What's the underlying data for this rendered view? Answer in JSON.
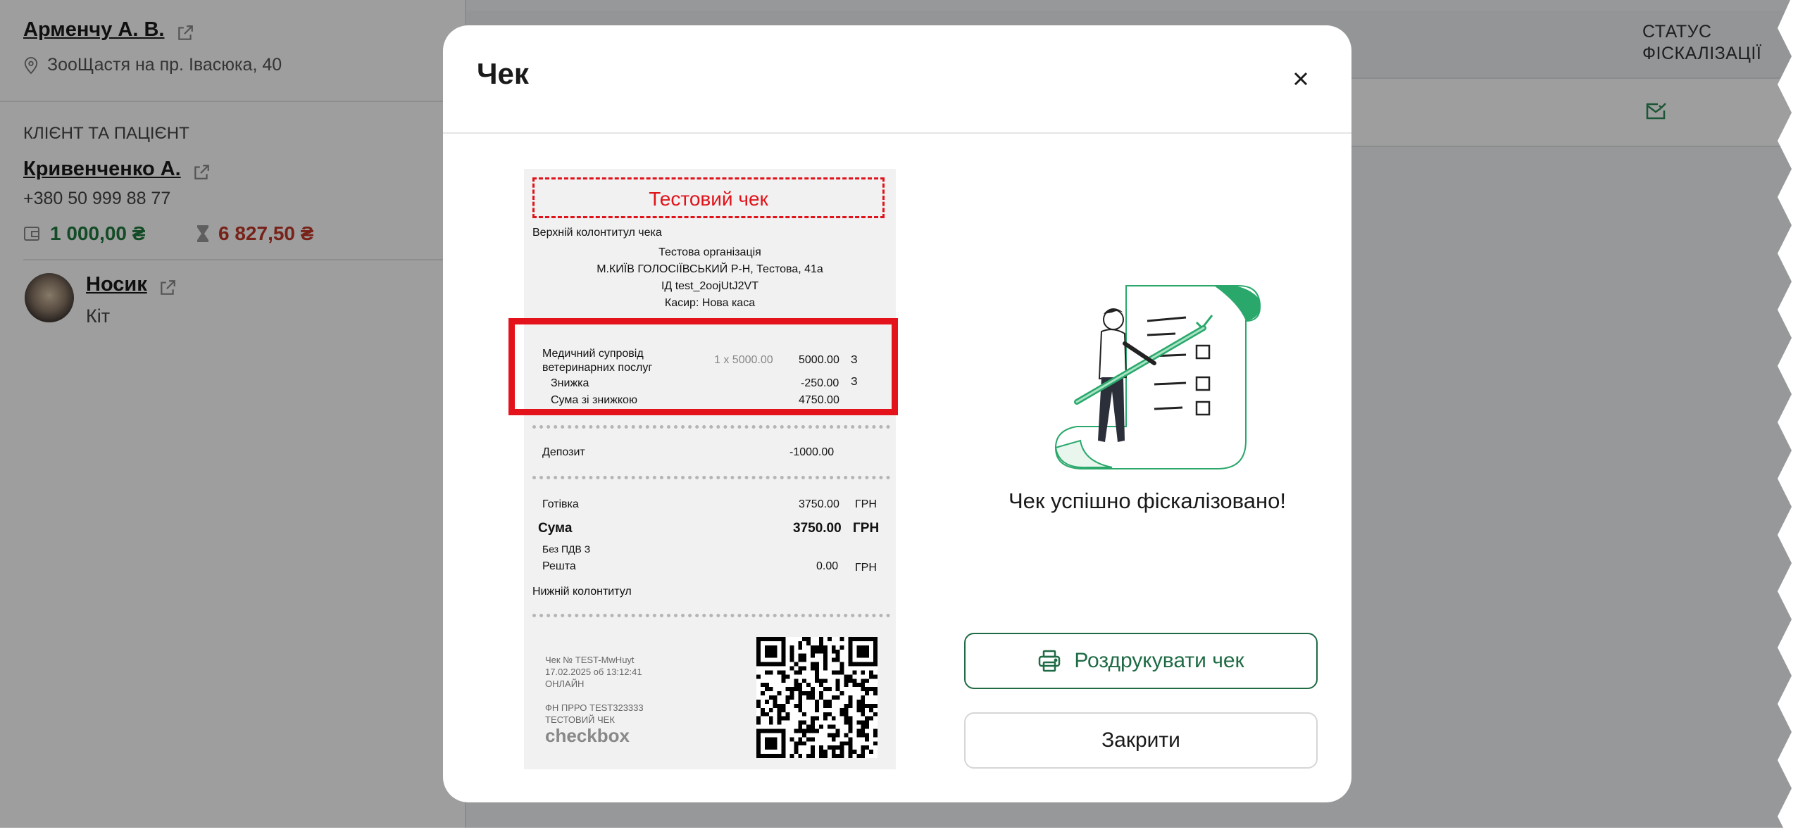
{
  "sidebar": {
    "doctor_name": "Арменчу А. В.",
    "clinic_address": "ЗооЩастя на пр. Івасюка, 40",
    "client_section_title": "КЛІЄНТ ТА ПАЦІЄНТ",
    "client_name": "Кривенченко А.",
    "client_phone": "+380 50 999 88 77",
    "balance": "1 000,00 ₴",
    "debt": "6 827,50 ₴",
    "pet_name": "Носик",
    "pet_species": "Кіт"
  },
  "table": {
    "status_header_line1": "СТАТУС",
    "status_header_line2": "ФІСКАЛІЗАЦІЇ"
  },
  "modal": {
    "title": "Чек",
    "success_message": "Чек успішно фіскалізовано!",
    "print_button": "Роздрукувати чек",
    "close_button": "Закрити"
  },
  "receipt": {
    "test_label": "Тестовий чек",
    "header_note": "Верхній колонтитул чека",
    "org_line": "Тестова організація",
    "address_line": "М.КИЇВ ГОЛОСІЇВСЬКИЙ Р-Н, Тестова, 41а",
    "id_line": "ІД test_2oojUtJ2VT",
    "cashier_line": "Касир: Нова каса",
    "item_name_1": "Медичний супровід",
    "item_name_2": "ветеринарних послуг",
    "item_qty": "1 x 5000.00",
    "item_total": "5000.00",
    "item_tax": "З",
    "discount_label": "Знижка",
    "discount_value": "-250.00",
    "discount_tax": "З",
    "after_discount_label": "Сума зі знижкою",
    "after_discount_value": "4750.00",
    "deposit_label": "Депозит",
    "deposit_value": "-1000.00",
    "cash_label": "Готівка",
    "cash_value": "3750.00",
    "currency": "ГРН",
    "sum_label": "Сума",
    "sum_value": "3750.00",
    "vat_note": "Без ПДВ З",
    "change_label": "Решта",
    "change_value": "0.00",
    "footer_note": "Нижній колонтитул",
    "check_no": "Чек № TEST-MwHuyt",
    "datetime": "17.02.2025 об 13:12:41",
    "mode": "ОНЛАЙН",
    "fn_line": "ФН ПРРО TEST323333",
    "test_check": "ТЕСТОВИЙ ЧЕК",
    "brand": "checkbox"
  },
  "colors": {
    "accent_green": "#1f6b45",
    "balance_green": "#1e7a3c",
    "debt_red": "#c0392b",
    "highlight_red": "#e4131b"
  }
}
